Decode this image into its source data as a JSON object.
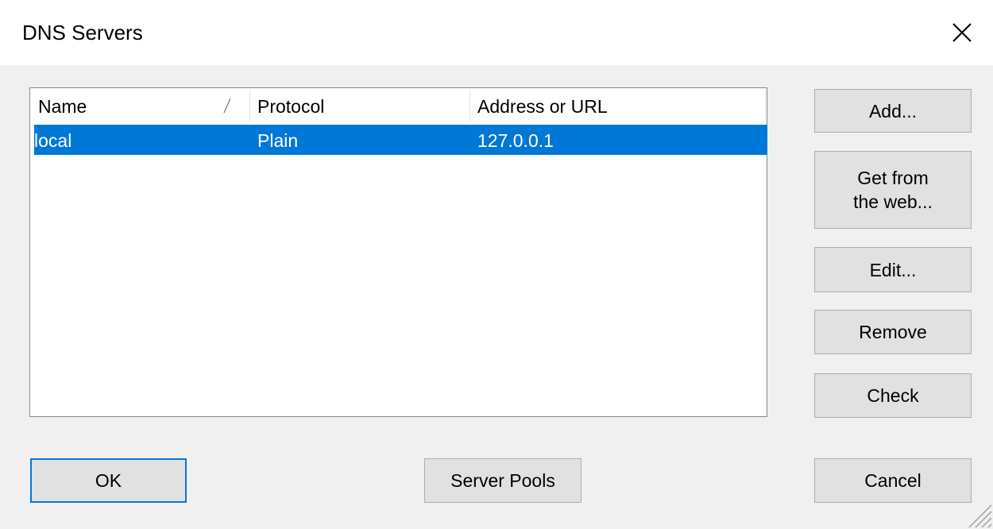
{
  "window": {
    "title": "DNS Servers"
  },
  "icons": {
    "close": "close-icon",
    "sort": "sort-indicator-icon",
    "grip": "resize-grip-icon"
  },
  "list": {
    "columns": [
      {
        "label": "Name"
      },
      {
        "label": "Protocol"
      },
      {
        "label": "Address or URL"
      }
    ],
    "rows": [
      {
        "name": "local",
        "protocol": "Plain",
        "address": "127.0.0.1",
        "selected": true
      }
    ]
  },
  "buttons": {
    "add": "Add...",
    "get_from_web_line1": "Get from",
    "get_from_web_line2": "the web...",
    "edit": "Edit...",
    "remove": "Remove",
    "check": "Check",
    "ok": "OK",
    "server_pools": "Server Pools",
    "cancel": "Cancel"
  },
  "colors": {
    "selection": "#0078d7",
    "default_button_border": "#0078d7",
    "dialog_background": "#f0f0f0"
  }
}
